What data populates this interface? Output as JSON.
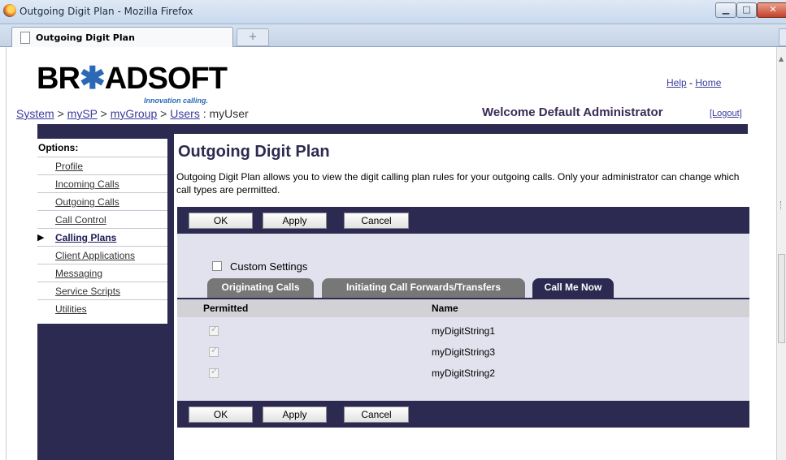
{
  "window": {
    "title": "Outgoing Digit Plan - Mozilla Firefox",
    "buttons": {
      "minimize": "▁",
      "maximize": "□",
      "close": "✕"
    }
  },
  "browser": {
    "tab_title": "Outgoing Digit Plan",
    "new_tab": "+"
  },
  "header": {
    "logo_prefix": "BR",
    "logo_star": "✱",
    "logo_suffix": "ADSOFT",
    "logo_tagline": "Innovation calling.",
    "help": "Help",
    "separator": " - ",
    "home": "Home",
    "breadcrumb": {
      "system": "System",
      "sep1": " > ",
      "mysp": "mySP",
      "sep2": " > ",
      "mygroup": "myGroup",
      "sep3": " > ",
      "users": "Users",
      "sep4": " : ",
      "user": "myUser"
    },
    "welcome": "Welcome Default Administrator",
    "logout": "[Logout]"
  },
  "nav": {
    "title": "Options:",
    "items": [
      {
        "label": "Profile"
      },
      {
        "label": "Incoming Calls"
      },
      {
        "label": "Outgoing Calls"
      },
      {
        "label": "Call Control"
      },
      {
        "label": "Calling Plans",
        "active": true
      },
      {
        "label": "Client Applications"
      },
      {
        "label": "Messaging"
      },
      {
        "label": "Service Scripts"
      },
      {
        "label": "Utilities"
      }
    ],
    "active_marker": "▶"
  },
  "page": {
    "title": "Outgoing Digit Plan",
    "description": "Outgoing Digit Plan allows you to view the digit calling plan rules for your outgoing calls. Only your administrator can change which call types are permitted."
  },
  "buttons": {
    "ok": "OK",
    "apply": "Apply",
    "cancel": "Cancel"
  },
  "custom_settings": {
    "label": "Custom Settings",
    "checked": false
  },
  "tabs": [
    {
      "label": "Originating Calls",
      "active": false
    },
    {
      "label": "Initiating Call Forwards/Transfers",
      "active": false
    },
    {
      "label": "Call Me Now",
      "active": true
    }
  ],
  "table": {
    "headers": {
      "permitted": "Permitted",
      "name": "Name"
    },
    "rows": [
      {
        "permitted": true,
        "name": "myDigitString1"
      },
      {
        "permitted": true,
        "name": "myDigitString3"
      },
      {
        "permitted": true,
        "name": "myDigitString2"
      }
    ],
    "checkmark": "✓"
  }
}
